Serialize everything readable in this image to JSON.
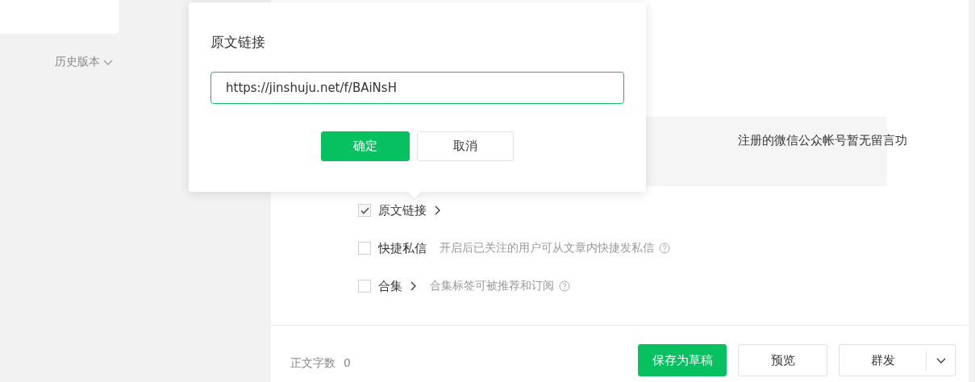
{
  "sidebar": {
    "history_link": "历史版本"
  },
  "notice": {
    "text": "注册的微信公众帐号暂无留言功"
  },
  "options": [
    {
      "kind": "link",
      "label": "原文链接",
      "checked": true
    },
    {
      "kind": "info",
      "label": "快捷私信",
      "checked": false,
      "hint": "开启后已关注的用户可从文章内快捷发私信"
    },
    {
      "kind": "link-info",
      "label": "合集",
      "checked": false,
      "hint": "合集标签可被推荐和订阅"
    }
  ],
  "footer": {
    "word_count_label": "正文字数",
    "word_count": "0",
    "buttons": [
      {
        "label": "保存为草稿",
        "kind": "primary"
      },
      {
        "label": "预览",
        "kind": "default"
      },
      {
        "label": "群发",
        "kind": "split"
      }
    ]
  },
  "dialog": {
    "title": "原文链接",
    "url": "https://jinshuju.net/f/BAiNsH",
    "buttons": [
      {
        "label": "确定",
        "kind": "primary"
      },
      {
        "label": "取消",
        "kind": "default"
      }
    ]
  }
}
